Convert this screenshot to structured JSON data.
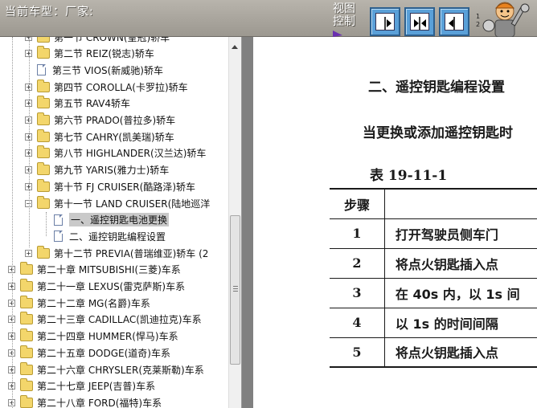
{
  "topbar": {
    "model_label": "当前车型：厂家:",
    "view_control_label": "视图控制",
    "buttons": [
      {
        "name": "view-left-panel-button",
        "icon": "panel-right-arrow-icon"
      },
      {
        "name": "view-split-button",
        "icon": "split-arrows-icon"
      },
      {
        "name": "view-right-panel-button",
        "icon": "panel-left-arrow-icon"
      }
    ],
    "corner_text": "1\\n2",
    "accent_color": "#5aa0d8"
  },
  "tree": {
    "items": [
      {
        "label": "第一节 CROWN(皇冠)轿车",
        "level": 2,
        "type": "folder",
        "toggle": "+"
      },
      {
        "label": "第二节 REIZ(锐志)轿车",
        "level": 2,
        "type": "folder",
        "toggle": "+"
      },
      {
        "label": "第三节 VIOS(新威驰)轿车",
        "level": 2,
        "type": "doc",
        "toggle": ""
      },
      {
        "label": "第四节 COROLLA(卡罗拉)轿车",
        "level": 2,
        "type": "folder",
        "toggle": "+"
      },
      {
        "label": "第五节 RAV4轿车",
        "level": 2,
        "type": "folder",
        "toggle": "+"
      },
      {
        "label": "第六节 PRADO(普拉多)轿车",
        "level": 2,
        "type": "folder",
        "toggle": "+"
      },
      {
        "label": "第七节 CAHRY(凯美瑞)轿车",
        "level": 2,
        "type": "folder",
        "toggle": "+"
      },
      {
        "label": "第八节 HIGHLANDER(汉兰达)轿车",
        "level": 2,
        "type": "folder",
        "toggle": "+"
      },
      {
        "label": "第九节 YARIS(雅力士)轿车",
        "level": 2,
        "type": "folder",
        "toggle": "+"
      },
      {
        "label": "第十节 FJ CRUISER(酷路泽)轿车",
        "level": 2,
        "type": "folder",
        "toggle": "+"
      },
      {
        "label": "第十一节 LAND CRUISER(陆地巡洋",
        "level": 2,
        "type": "folder-open",
        "toggle": "-"
      },
      {
        "label": "一、遥控钥匙电池更换",
        "level": 3,
        "type": "doc",
        "toggle": "",
        "selected": true
      },
      {
        "label": "二、遥控钥匙编程设置",
        "level": 3,
        "type": "doc",
        "toggle": ""
      },
      {
        "label": "第十二节 PREVIA(普瑞维亚)轿车 (2",
        "level": 2,
        "type": "folder",
        "toggle": "+"
      },
      {
        "label": "第二十章 MITSUBISHI(三菱)车系",
        "level": 1,
        "type": "folder",
        "toggle": "+"
      },
      {
        "label": "第二十一章 LEXUS(雷克萨斯)车系",
        "level": 1,
        "type": "folder",
        "toggle": "+"
      },
      {
        "label": "第二十二章 MG(名爵)车系",
        "level": 1,
        "type": "folder",
        "toggle": "+"
      },
      {
        "label": "第二十三章 CADILLAC(凯迪拉克)车系",
        "level": 1,
        "type": "folder",
        "toggle": "+"
      },
      {
        "label": "第二十四章 HUMMER(悍马)车系",
        "level": 1,
        "type": "folder",
        "toggle": "+"
      },
      {
        "label": "第二十五章 DODGE(道奇)车系",
        "level": 1,
        "type": "folder",
        "toggle": "+"
      },
      {
        "label": "第二十六章 CHRYSLER(克莱斯勒)车系",
        "level": 1,
        "type": "folder",
        "toggle": "+"
      },
      {
        "label": "第二十七章 JEEP(吉普)车系",
        "level": 1,
        "type": "folder",
        "toggle": "+"
      },
      {
        "label": "第二十八章 FORD(福特)车系",
        "level": 1,
        "type": "folder",
        "toggle": "+"
      }
    ]
  },
  "document": {
    "heading": "二、遥控钥匙编程设置",
    "paragraph": "当更换或添加遥控钥匙时",
    "table_caption": "表 19-11-1",
    "table_header": [
      "步骤",
      ""
    ],
    "steps": [
      {
        "num": "1",
        "text": "打开驾驶员侧车门"
      },
      {
        "num": "2",
        "text": "将点火钥匙插入点"
      },
      {
        "num": "3",
        "text": "在 40s 内，以 1s 间"
      },
      {
        "num": "4",
        "text": "以 1s 的时间间隔"
      },
      {
        "num": "5",
        "text": "将点火钥匙插入点"
      }
    ]
  }
}
